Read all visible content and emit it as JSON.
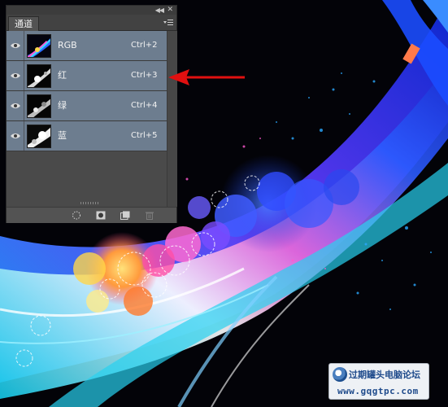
{
  "panel": {
    "tab_label": "通道",
    "collapse_icon": "double-chevron-icon",
    "close_icon": "close-icon",
    "menu_icon": "panel-menu-icon",
    "channels": [
      {
        "name": "RGB",
        "shortcut": "Ctrl+2",
        "visible": true
      },
      {
        "name": "红",
        "shortcut": "Ctrl+3",
        "visible": true
      },
      {
        "name": "绿",
        "shortcut": "Ctrl+4",
        "visible": true
      },
      {
        "name": "蓝",
        "shortcut": "Ctrl+5",
        "visible": true
      }
    ],
    "bottom_buttons": [
      {
        "icon": "load-channel-as-selection-icon"
      },
      {
        "icon": "save-selection-as-channel-icon"
      },
      {
        "icon": "new-channel-icon"
      },
      {
        "icon": "delete-channel-icon"
      }
    ],
    "row_highlight_color": "#6d7d8f"
  },
  "annotation": {
    "icon": "red-arrow-icon",
    "color": "#e01010"
  },
  "watermark": {
    "text": "过期罐头电脑论坛",
    "url": "www.gqgtpc.com"
  }
}
